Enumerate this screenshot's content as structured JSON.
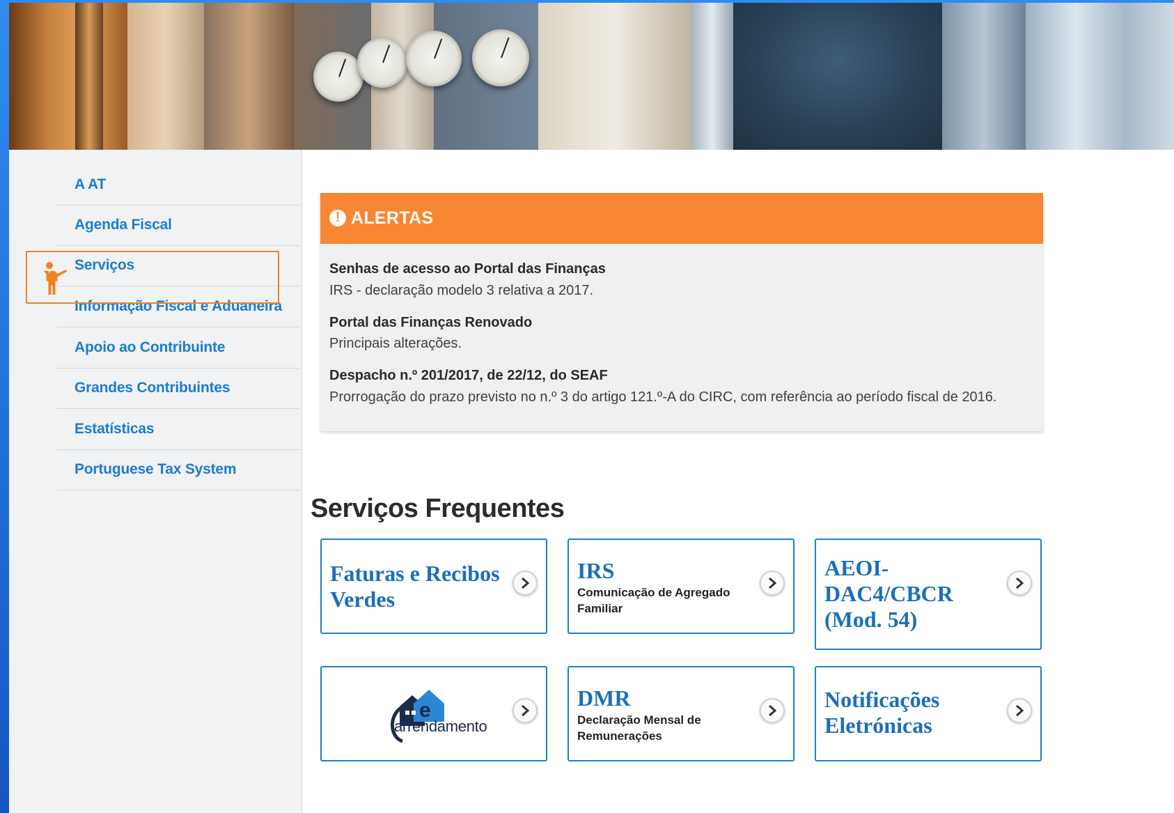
{
  "sidebar": {
    "items": [
      {
        "label": "A AT"
      },
      {
        "label": "Agenda Fiscal"
      },
      {
        "label": "Serviços"
      },
      {
        "label": "Informação Fiscal e Aduaneira"
      },
      {
        "label": "Apoio ao Contribuinte"
      },
      {
        "label": "Grandes Contribuintes"
      },
      {
        "label": "Estatísticas"
      },
      {
        "label": "Portuguese Tax System"
      }
    ],
    "highlighted_item": "Serviços",
    "highlight_color": "#f0831f",
    "link_color": "#1c7cd0"
  },
  "alerts": {
    "icon": "exclamation-circle-icon",
    "title": "ALERTAS",
    "header_color": "#f98633",
    "items": [
      {
        "title": "Senhas de acesso ao Portal das Finanças",
        "desc": "IRS - declaração modelo 3 relativa a 2017."
      },
      {
        "title": "Portal das Finanças Renovado",
        "desc": "Principais alterações."
      },
      {
        "title": "Despacho n.º 201/2017, de 22/12, do SEAF",
        "desc": "Prorrogação do prazo previsto no n.º 3 do artigo 121.º-A do CIRC, com referência ao período fiscal de 2016."
      }
    ]
  },
  "services": {
    "title": "Serviços Frequentes",
    "border_color": "#1a80cc",
    "cards": [
      {
        "title": "Faturas e Recibos Verdes",
        "title_lines": [
          "Faturas e Recibos",
          "Verdes"
        ]
      },
      {
        "title": "IRS",
        "subtitle_lines": [
          "Comunicação de Agregado",
          "Familiar"
        ]
      },
      {
        "title": "AEOI-DAC4/CBCR (Mod. 54)",
        "title_lines": [
          "AEOI-",
          "DAC4/CBCR",
          "(Mod. 54)"
        ]
      },
      {
        "logo_letter": "e",
        "logo_text": "arrendamento",
        "icon": "house-icon"
      },
      {
        "title": "DMR",
        "subtitle_lines": [
          "Declaração Mensal de",
          "Remunerações"
        ]
      },
      {
        "title": "Notificações Eletrónicas",
        "title_lines": [
          "Notificações",
          "Eletrónicas"
        ]
      }
    ],
    "chevron_icon": "chevron-right-icon"
  }
}
